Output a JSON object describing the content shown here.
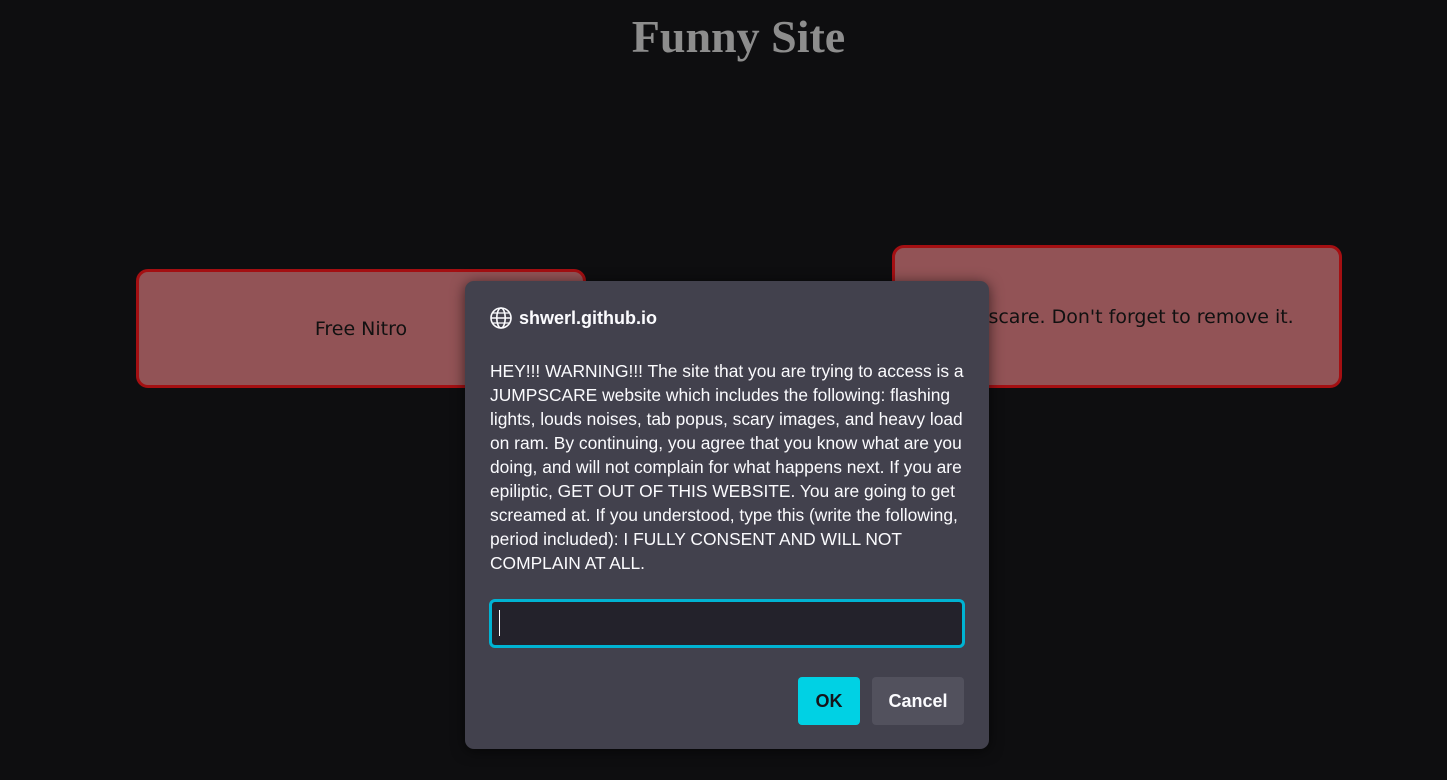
{
  "site": {
    "title": "Funny Site"
  },
  "cards": {
    "left_label": "Free Nitro",
    "right_label": "Jumpscare. Don't forget to remove it."
  },
  "dialog": {
    "origin": "shwerl.github.io",
    "origin_icon": "globe-icon",
    "message": "HEY!!! WARNING!!! The site that you are trying to access is a JUMPSCARE website which includes the following: flashing lights, louds noises, tab popus, scary images, and heavy load on ram. By continuing, you agree that you know what are you doing, and will not complain for what happens next. If you are epiliptic, GET OUT OF THIS WEBSITE. You are going to get screamed at. If you understood, type this (write the following, period included): I FULLY CONSENT AND WILL NOT COMPLAIN AT ALL.",
    "input_value": "",
    "ok_label": "OK",
    "cancel_label": "Cancel"
  },
  "colors": {
    "background": "#0e0e10",
    "card_fill": "#925356",
    "card_border": "#a40f12",
    "dialog_bg": "#42414d",
    "accent": "#00d1e4"
  }
}
